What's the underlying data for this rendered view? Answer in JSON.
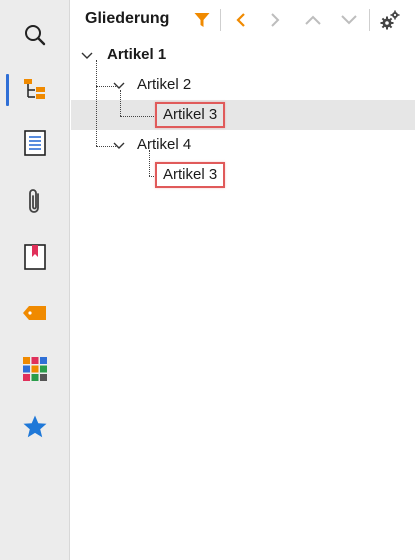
{
  "panel": {
    "title": "Gliederung"
  },
  "toolbar": {
    "filter_icon": "filter-icon",
    "prev_icon": "chevron-left-icon",
    "next_icon": "chevron-right-icon",
    "up_icon": "chevron-up-icon",
    "down_icon": "chevron-down-icon",
    "settings_icon": "gears-icon"
  },
  "sidebar": {
    "items": [
      {
        "icon": "search-icon"
      },
      {
        "icon": "outline-tree-icon",
        "active": true
      },
      {
        "icon": "document-icon"
      },
      {
        "icon": "paperclip-icon"
      },
      {
        "icon": "bookmark-icon"
      },
      {
        "icon": "tag-icon"
      },
      {
        "icon": "tiles-icon"
      },
      {
        "icon": "star-icon"
      }
    ]
  },
  "tree": {
    "nodes": [
      {
        "label": "Artikel 1",
        "level": 0,
        "expanded": true
      },
      {
        "label": "Artikel 2",
        "level": 1,
        "expanded": true
      },
      {
        "label": "Artikel 3",
        "level": 2,
        "selected": true,
        "highlighted": true
      },
      {
        "label": "Artikel 4",
        "level": 1,
        "expanded": true
      },
      {
        "label": "Artikel 3",
        "level": 2,
        "highlighted": true
      }
    ]
  },
  "colors": {
    "accent_orange": "#f08a00",
    "active_blue": "#2f6fd6",
    "highlight_red": "#e05a5a",
    "selection_gray": "#e6e6e6"
  }
}
